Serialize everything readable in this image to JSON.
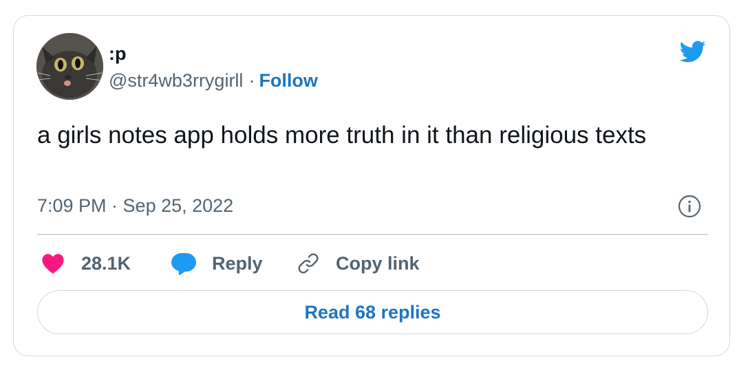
{
  "author": {
    "display_name": ":p",
    "handle": "@str4wb3rrygirll",
    "separator": "·",
    "follow_label": "Follow"
  },
  "tweet": {
    "text": "a girls notes app holds more truth in it than religious texts",
    "timestamp": "7:09 PM · Sep 25, 2022"
  },
  "actions": {
    "like_count": "28.1K",
    "reply_label": "Reply",
    "copy_link_label": "Copy link"
  },
  "footer": {
    "read_replies_label": "Read 68 replies"
  },
  "icons": {
    "brand": "twitter-bird-icon",
    "info": "info-icon",
    "like": "heart-icon",
    "reply": "speech-bubble-icon",
    "copy": "link-icon"
  },
  "colors": {
    "brand_blue": "#1d9bf0",
    "link_blue": "#1d75c2",
    "heart_pink": "#f91880",
    "text_primary": "#0f1419",
    "text_secondary": "#536471",
    "border": "#cfd9de"
  }
}
